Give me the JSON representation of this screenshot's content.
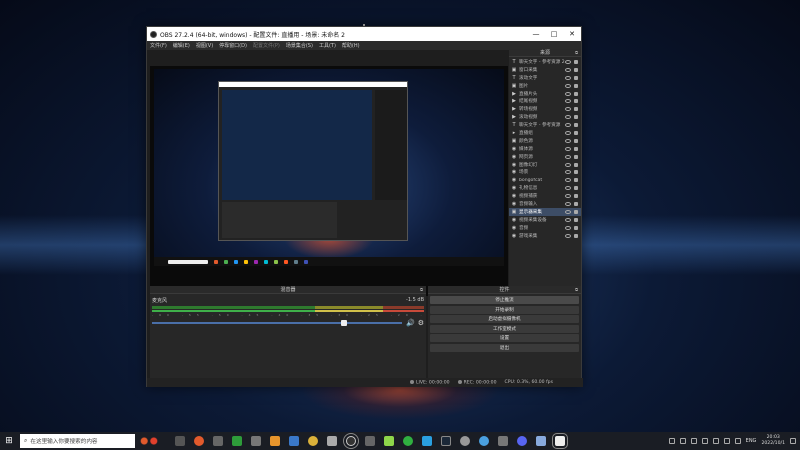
{
  "window": {
    "title": "OBS 27.2.4 (64-bit, windows) - 配置文件: 直播用 - 场景: 未命名 2",
    "controls": [
      "—",
      "□",
      "✕"
    ]
  },
  "menu": [
    "文件(F)",
    "编辑(E)",
    "视图(V)",
    "停靠窗口(D)",
    "配置文件(P)",
    "场景集合(S)",
    "工具(T)",
    "帮助(H)"
  ],
  "sources": {
    "title": "来源",
    "items": [
      {
        "icon": "T",
        "name": "聊天文字 - 参考资源 2",
        "selected": false
      },
      {
        "icon": "▣",
        "name": "窗口采集",
        "selected": false
      },
      {
        "icon": "T",
        "name": "滚动文字",
        "selected": false
      },
      {
        "icon": "▣",
        "name": "图片",
        "selected": false
      },
      {
        "icon": "▶",
        "name": "直播片头",
        "selected": false
      },
      {
        "icon": "▶",
        "name": "结尾视频",
        "selected": false
      },
      {
        "icon": "▶",
        "name": "转场视频",
        "selected": false
      },
      {
        "icon": "▶",
        "name": "滚动视频",
        "selected": false
      },
      {
        "icon": "T",
        "name": "聊天文字 - 参考资源",
        "selected": false
      },
      {
        "icon": "▸",
        "name": "直播组",
        "selected": false
      },
      {
        "icon": "▣",
        "name": "颜色源",
        "selected": false
      },
      {
        "icon": "◉",
        "name": "媒体源",
        "selected": false
      },
      {
        "icon": "◉",
        "name": "网页源",
        "selected": false
      },
      {
        "icon": "◉",
        "name": "图像幻灯",
        "selected": false
      },
      {
        "icon": "◉",
        "name": "场景",
        "selected": false
      },
      {
        "icon": "◉",
        "name": "bongofcat",
        "selected": false
      },
      {
        "icon": "◉",
        "name": "礼物信息",
        "selected": false
      },
      {
        "icon": "◉",
        "name": "视频捕获",
        "selected": false
      },
      {
        "icon": "◉",
        "name": "音频输入",
        "selected": false
      },
      {
        "icon": "▣",
        "name": "显示器采集",
        "selected": true
      },
      {
        "icon": "◉",
        "name": "视频采集设备",
        "selected": false
      },
      {
        "icon": "◉",
        "name": "音频",
        "selected": false
      },
      {
        "icon": "◉",
        "name": "游戏采集",
        "selected": false
      }
    ],
    "toolbar": [
      "+",
      "−",
      "⚙",
      "∧",
      "∨"
    ]
  },
  "mixer": {
    "title": "混音器",
    "track_name": "麦克风",
    "level": "-1.5 dB",
    "ticks": "-60 -55 -50 -45 -40 -35 -30 -25 -20 -15 -10 -5 0"
  },
  "controls": {
    "title": "控件",
    "buttons": [
      "停止推流",
      "开始录制",
      "启动虚拟摄像机",
      "工作室模式",
      "设置",
      "退出"
    ]
  },
  "status": {
    "live": "LIVE: 00:00:00",
    "rec": "REC: 00:00:00",
    "cpu": "CPU: 0.3%, 60.00 fps"
  },
  "taskbar": {
    "search_placeholder": "在这里输入你要搜索的内容",
    "lang": "ENG",
    "time": "20:03",
    "date": "2022/10/1"
  }
}
